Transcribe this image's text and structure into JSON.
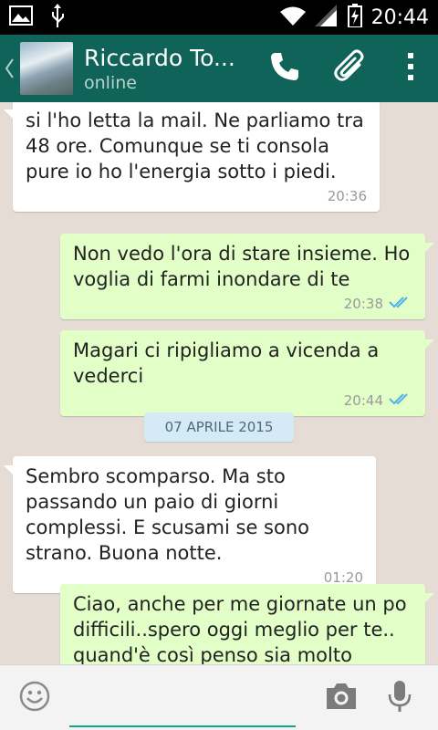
{
  "status_bar": {
    "time": "20:44",
    "icons": [
      "image-icon",
      "usb-icon",
      "wifi-icon",
      "signal-icon",
      "battery-charging-icon"
    ]
  },
  "header": {
    "contact_name": "Riccardo To...",
    "status": "online",
    "actions": [
      "call-icon",
      "attach-icon",
      "overflow-menu-icon"
    ]
  },
  "messages": [
    {
      "direction": "in",
      "text": "si l'ho letta la mail. Ne parliamo tra 48 ore. Comunque se ti consola pure io ho l'energia sotto i piedi.",
      "time": "20:36"
    },
    {
      "direction": "out",
      "text": "Non vedo l'ora di stare insieme. Ho voglia di farmi inondare di te",
      "time": "20:38",
      "read": true
    },
    {
      "direction": "out",
      "text": "Magari ci ripigliamo a vicenda a vederci",
      "time": "20:44",
      "read": true
    },
    {
      "direction": "in",
      "text": "Sembro scomparso. Ma sto passando un paio di giorni complessi. E scusami se sono strano. Buona notte.",
      "time": "01:20"
    },
    {
      "direction": "out",
      "text": "Ciao, anche per me giornate un po difficili..spero oggi meglio per te.. quand'è così penso sia molto",
      "time": ""
    }
  ],
  "date_separator": "07 APRILE 2015",
  "input": {
    "value": "",
    "placeholder": ""
  },
  "colors": {
    "header": "#0f6358",
    "incoming_bubble": "#ffffff",
    "outgoing_bubble": "#e2ffc8",
    "read_ticks": "#4fb2e8",
    "chat_bg": "#e5ddd5"
  }
}
